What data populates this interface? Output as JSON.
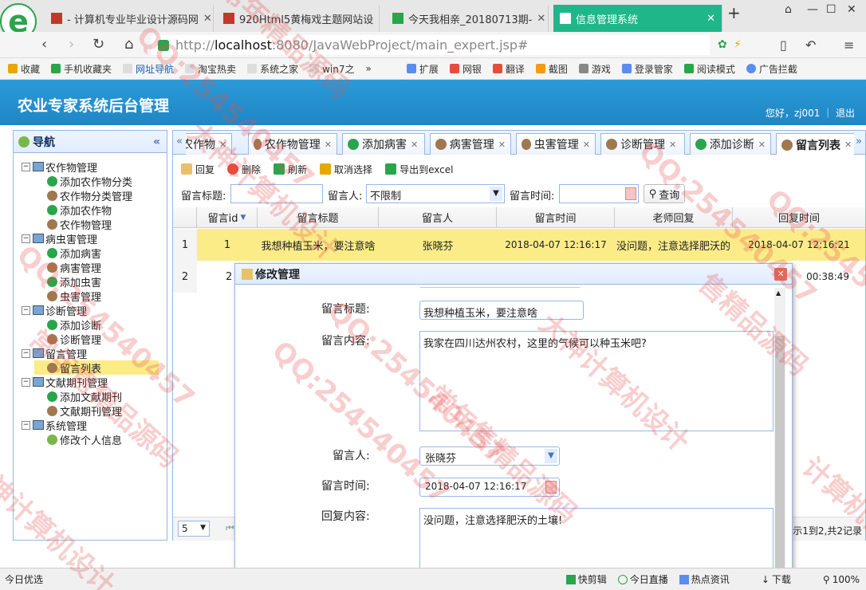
{
  "browser": {
    "tabs": [
      {
        "title": "- 计算机专业毕业设计源码网"
      },
      {
        "title": "920Html5黄梅戏主题网站设"
      },
      {
        "title": "今天我相亲_20180713期- "
      },
      {
        "title": "信息管理系统"
      }
    ],
    "url_prefix": "http://",
    "url_domain": "localhost",
    "url_rest": ":8080/JavaWebProject/main_expert.jsp#",
    "bookmarks": [
      "收藏",
      "手机收藏夹",
      "网址导航",
      "淘宝热卖",
      "系统之家",
      "win7之",
      "»"
    ],
    "bookmarks_right": [
      "扩展",
      "网银",
      "翻译",
      "截图",
      "游戏",
      "登录管家",
      "阅读模式",
      "广告拦截"
    ]
  },
  "app": {
    "title": "农业专家系统后台管理",
    "user_text": "您好，zj001 ｜ 退出"
  },
  "nav": {
    "title": "导航",
    "items": [
      {
        "label": "农作物管理",
        "type": "folder"
      },
      {
        "label": "添加农作物分类",
        "type": "add"
      },
      {
        "label": "农作物分类管理",
        "type": "user"
      },
      {
        "label": "添加农作物",
        "type": "add"
      },
      {
        "label": "农作物管理",
        "type": "user"
      },
      {
        "label": "病虫害管理",
        "type": "folder"
      },
      {
        "label": "添加病害",
        "type": "add"
      },
      {
        "label": "病害管理",
        "type": "user"
      },
      {
        "label": "添加虫害",
        "type": "add"
      },
      {
        "label": "虫害管理",
        "type": "user"
      },
      {
        "label": "诊断管理",
        "type": "folder"
      },
      {
        "label": "添加诊断",
        "type": "add"
      },
      {
        "label": "诊断管理",
        "type": "user"
      },
      {
        "label": "留言管理",
        "type": "folder"
      },
      {
        "label": "留言列表",
        "type": "user"
      },
      {
        "label": "文献期刊管理",
        "type": "folder"
      },
      {
        "label": "添加文献期刊",
        "type": "add"
      },
      {
        "label": "文献期刊管理",
        "type": "user"
      },
      {
        "label": "系统管理",
        "type": "folder"
      },
      {
        "label": "修改个人信息",
        "type": "edit"
      }
    ]
  },
  "panel_tabs": [
    "农作物",
    "农作物管理",
    "添加病害",
    "病害管理",
    "虫害管理",
    "诊断管理",
    "添加诊断",
    "留言列表"
  ],
  "toolbar": [
    "回复",
    "删除",
    "刷新",
    "取消选择",
    "导出到excel"
  ],
  "filter": {
    "title_label": "留言标题:",
    "user_label": "留言人:",
    "user_value": "不限制",
    "time_label": "留言时间:",
    "query_label": "查询"
  },
  "grid": {
    "columns": [
      "留言id",
      "留言标题",
      "留言人",
      "留言时间",
      "老师回复",
      "回复时间"
    ],
    "rows": [
      {
        "num": "1",
        "id": "1",
        "title": "我想种植玉米，要注意啥",
        "user": "张晓芬",
        "time": "2018-04-07 12:16:17",
        "reply": "没问题，注意选择肥沃的",
        "reply_time": "2018-04-07 12:16:21"
      },
      {
        "num": "2",
        "id": "2",
        "title": "",
        "user": "",
        "time": "",
        "reply": "",
        "reply_time": "00:38:49"
      }
    ]
  },
  "pager": {
    "page_size": "5",
    "info": "示1到2,共2记录"
  },
  "dialog": {
    "title": "修改管理",
    "fields": {
      "title_label": "留言标题:",
      "title_value": "我想种植玉米，要注意啥",
      "content_label": "留言内容:",
      "content_value": "我家在四川达州农村，这里的气候可以种玉米吧?",
      "user_label": "留言人:",
      "user_value": "张晓芬",
      "time_label": "留言时间:",
      "time_value": "2018-04-07 12:16:17",
      "reply_label": "回复内容:",
      "reply_value": "没问题，注意选择肥沃的土壤!"
    }
  },
  "statusbar": {
    "left": "今日优选",
    "items": [
      "快剪辑",
      "今日直播",
      "热点资讯",
      "下载",
      "100%"
    ]
  },
  "watermarks": [
    "QQ:254540457",
    "常年精品源码",
    "大神计算机设计",
    "QQ:254540457",
    "常年售精品源码",
    "大神计算机设计",
    "QQ:254540457",
    "QQ:254540457",
    "常年售精品源码",
    "大神计算机设计",
    "QQ:254540457",
    "售精品源码",
    "QQ:254540457",
    "计算机设计"
  ],
  "colors": {
    "header": "#2b9bd8",
    "active_tab": "#1fb68a",
    "selected_row": "#fbec88",
    "border": "#95b8e7",
    "watermark": "#e65050"
  }
}
